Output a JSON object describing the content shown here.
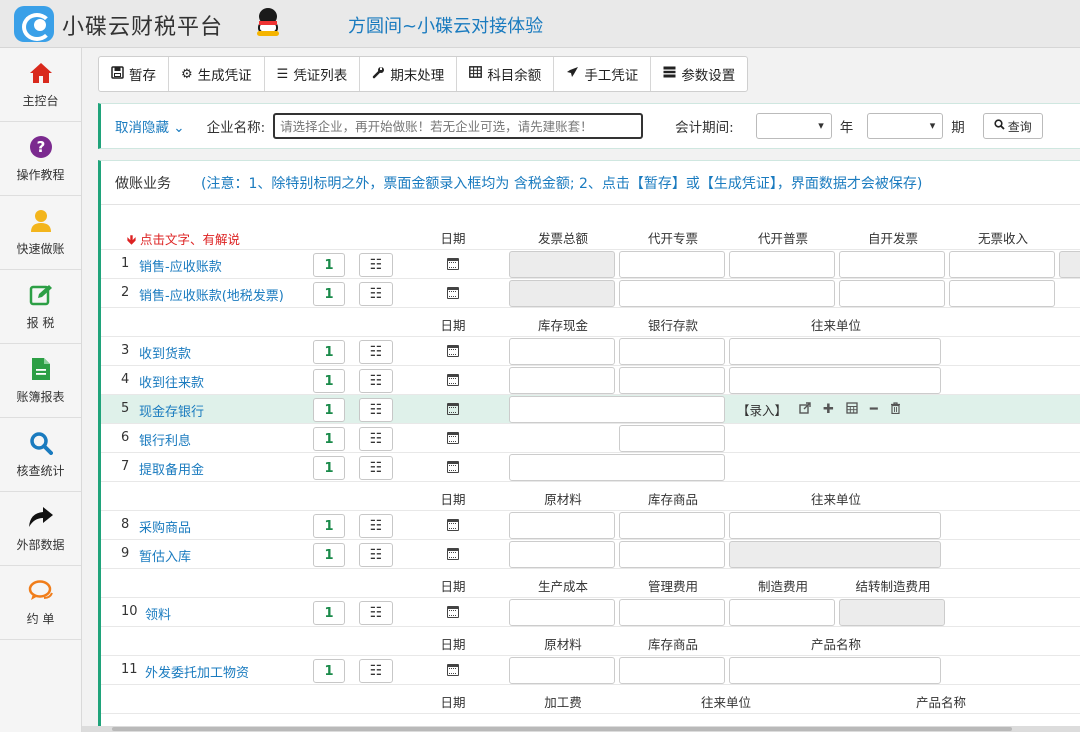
{
  "header": {
    "app_title": "小碟云财税平台",
    "company_title": "方圆间~小碟云对接体验"
  },
  "sidebar": {
    "items": [
      {
        "label": "主控台",
        "icon": "home-icon",
        "color": "#d9291c"
      },
      {
        "label": "操作教程",
        "icon": "question-icon",
        "color": "#7b2a8f"
      },
      {
        "label": "快速做账",
        "icon": "user-icon",
        "color": "#f3b51c"
      },
      {
        "label": "报 税",
        "icon": "edit-icon",
        "color": "#2c9f45"
      },
      {
        "label": "账簿报表",
        "icon": "document-icon",
        "color": "#2c9f45"
      },
      {
        "label": "核查统计",
        "icon": "search-icon",
        "color": "#1a7bbf"
      },
      {
        "label": "外部数据",
        "icon": "share-arrow-icon",
        "color": "#111111"
      },
      {
        "label": "约 单",
        "icon": "chat-icon",
        "color": "#f07d1a"
      }
    ]
  },
  "toolbar": {
    "buttons": [
      {
        "label": "暂存",
        "icon": "save-icon"
      },
      {
        "label": "生成凭证",
        "icon": "gears-icon"
      },
      {
        "label": "凭证列表",
        "icon": "list-icon"
      },
      {
        "label": "期末处理",
        "icon": "wrench-icon"
      },
      {
        "label": "科目余额",
        "icon": "table-icon"
      },
      {
        "label": "手工凭证",
        "icon": "rocket-icon"
      },
      {
        "label": "参数设置",
        "icon": "settings-list-icon"
      }
    ]
  },
  "filter": {
    "hide_label": "取消隐藏",
    "company_label": "企业名称:",
    "company_placeholder": "请选择企业，再开始做账！若无企业可选，请先建账套！",
    "period_label": "会计期间:",
    "year_unit": "年",
    "period_unit": "期",
    "query_label": "查询"
  },
  "main": {
    "title": "做账业务",
    "note": "(注意：1、除特别标明之外，票面金额录入框均为 含税金额;  2、点击【暂存】或【生成凭证】，界面数据才会被保存)",
    "explain": "点击文字、有解说",
    "one_label": "1",
    "entry_label": "【录入】",
    "groups": [
      {
        "headers": [
          "日期",
          "发票总额",
          "代开专票",
          "代开普票",
          "自开发票",
          "无票收入"
        ],
        "rows": [
          {
            "num": "1",
            "name": "销售-应收账款"
          },
          {
            "num": "2",
            "name": "销售-应收账款(地税发票)"
          }
        ]
      },
      {
        "headers": [
          "日期",
          "库存现金",
          "银行存款",
          "往来单位"
        ],
        "rows": [
          {
            "num": "3",
            "name": "收到货款"
          },
          {
            "num": "4",
            "name": "收到往来款"
          },
          {
            "num": "5",
            "name": "现金存银行"
          },
          {
            "num": "6",
            "name": "银行利息"
          },
          {
            "num": "7",
            "name": "提取备用金"
          }
        ]
      },
      {
        "headers": [
          "日期",
          "原材料",
          "库存商品",
          "往来单位"
        ],
        "rows": [
          {
            "num": "8",
            "name": "采购商品"
          },
          {
            "num": "9",
            "name": "暂估入库"
          }
        ]
      },
      {
        "headers": [
          "日期",
          "生产成本",
          "管理费用",
          "制造费用",
          "结转制造费用"
        ],
        "rows": [
          {
            "num": "10",
            "name": "领料"
          }
        ]
      },
      {
        "headers": [
          "日期",
          "原材料",
          "库存商品",
          "产品名称"
        ],
        "rows": [
          {
            "num": "11",
            "name": "外发委托加工物资"
          }
        ]
      },
      {
        "headers": [
          "日期",
          "加工费",
          "往来单位",
          "产品名称"
        ],
        "rows": []
      }
    ]
  }
}
